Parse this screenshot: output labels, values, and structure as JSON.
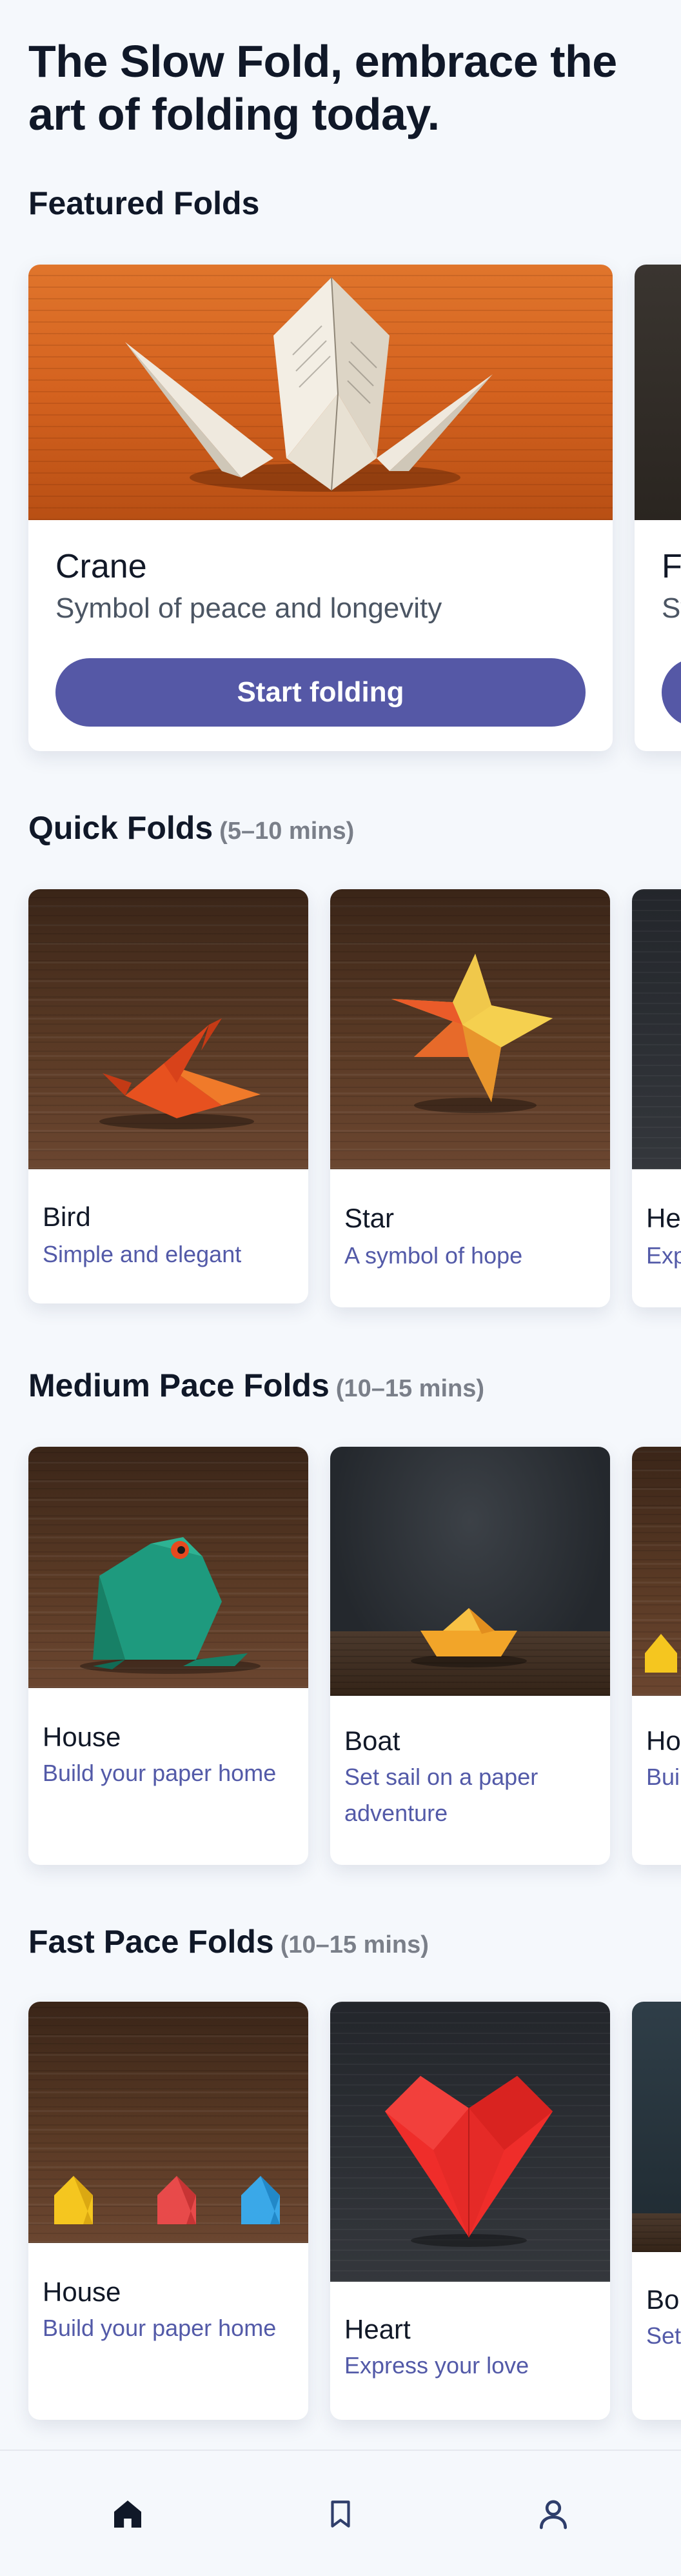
{
  "headline": "The Slow Fold, embrace the art of folding today.",
  "featured": {
    "title": "Featured Folds",
    "cards": [
      {
        "name": "Crane",
        "description": "Symbol of peace and longevity",
        "button": "Start folding"
      },
      {
        "name": "F",
        "description": "Sy"
      }
    ]
  },
  "quick": {
    "title": "Quick Folds",
    "duration": "(5–10 mins)",
    "cards": [
      {
        "name": "Bird",
        "tagline": "Simple and elegant"
      },
      {
        "name": "Star",
        "tagline": "A symbol of hope"
      },
      {
        "name": "He",
        "tagline": "Exp"
      }
    ]
  },
  "medium": {
    "title": "Medium Pace Folds",
    "duration": "(10–15 mins)",
    "cards": [
      {
        "name": "House",
        "tagline": "Build your paper home"
      },
      {
        "name": "Boat",
        "tagline": "Set sail on a paper adventure"
      },
      {
        "name": "Ho",
        "tagline": "Bui hon"
      }
    ]
  },
  "fast": {
    "title": "Fast Pace Folds",
    "duration": "(10–15 mins)",
    "cards": [
      {
        "name": "House",
        "tagline": "Build your paper home"
      },
      {
        "name": "Heart",
        "tagline": "Express your love"
      },
      {
        "name": "Bo",
        "tagline": "Set adv"
      }
    ]
  },
  "nav": {
    "items": [
      {
        "icon": "home-icon",
        "active": true
      },
      {
        "icon": "bookmark-icon",
        "active": false
      },
      {
        "icon": "profile-icon",
        "active": false
      }
    ]
  },
  "colors": {
    "accent": "#5558a6",
    "tagline": "#535aa8",
    "background": "#f5f8fc"
  }
}
